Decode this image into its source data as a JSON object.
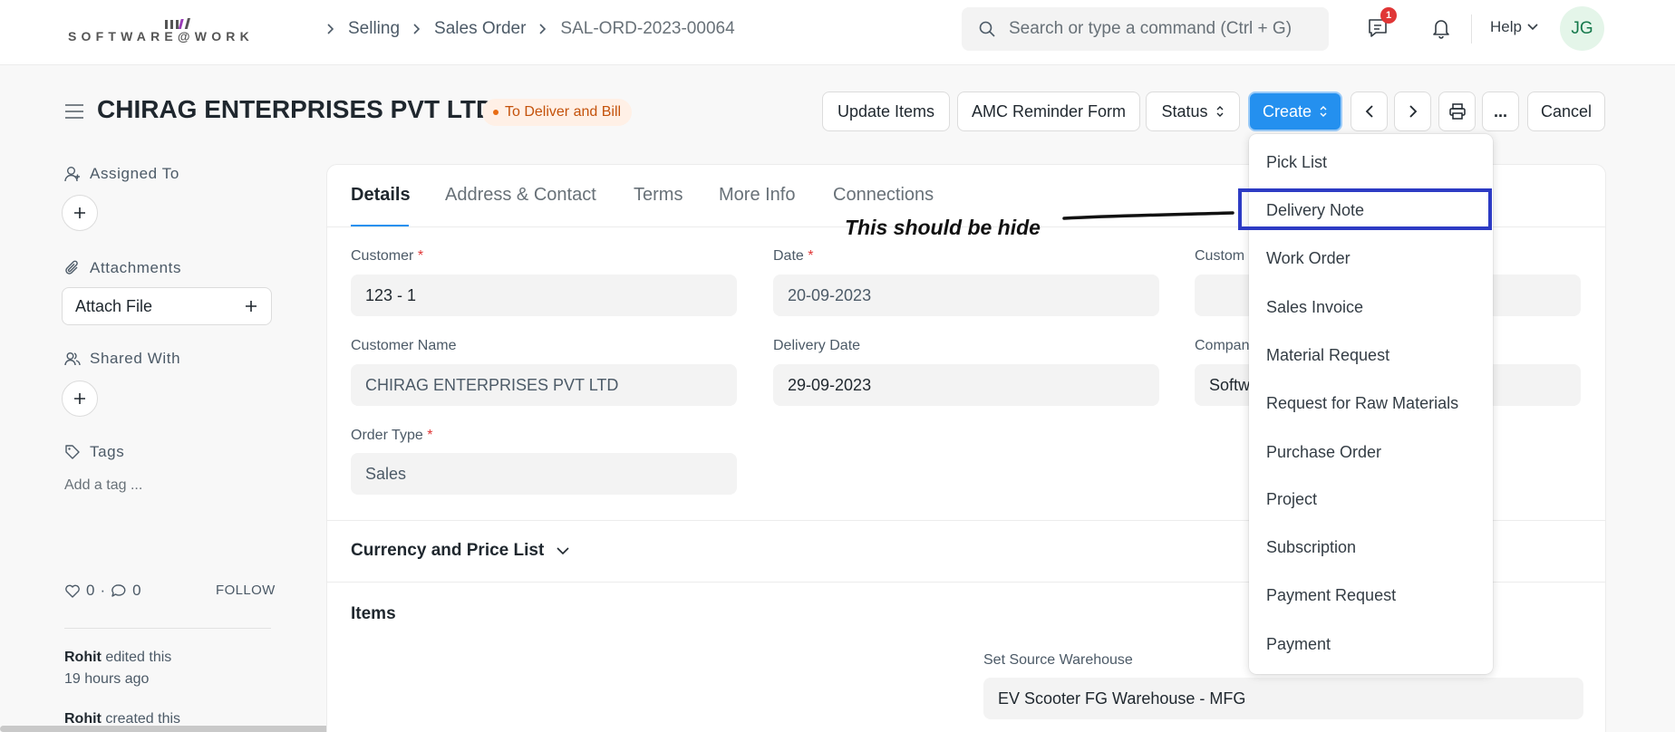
{
  "app": {
    "logo_text": "SOFTWARE@WORK"
  },
  "breadcrumbs": [
    "Selling",
    "Sales Order",
    "SAL-ORD-2023-00064"
  ],
  "search": {
    "placeholder": "Search or type a command (Ctrl + G)"
  },
  "navbar": {
    "notification_count": "1",
    "help_label": "Help",
    "avatar_initials": "JG"
  },
  "page": {
    "title": "CHIRAG ENTERPRISES PVT LTD",
    "status": "To Deliver and Bill"
  },
  "toolbar": {
    "update_items": "Update Items",
    "amc_reminder": "AMC Reminder Form",
    "status": "Status",
    "create": "Create",
    "more": "...",
    "cancel": "Cancel"
  },
  "sidebar": {
    "assigned_to": "Assigned To",
    "attachments": "Attachments",
    "attach_file": "Attach File",
    "shared_with": "Shared With",
    "tags": "Tags",
    "add_tag": "Add a tag ...",
    "likes": "0",
    "comments": "0",
    "follow": "FOLLOW",
    "activity": [
      {
        "user": "Rohit",
        "action": "edited this",
        "time": "19 hours ago"
      },
      {
        "user": "Rohit",
        "action": "created this"
      }
    ]
  },
  "tabs": [
    "Details",
    "Address & Contact",
    "Terms",
    "More Info",
    "Connections"
  ],
  "fields": {
    "customer_label": "Customer",
    "customer_value": "123 - 1",
    "date_label": "Date",
    "date_value": "20-09-2023",
    "customer_po_label": "Custom",
    "customer_name_label": "Customer Name",
    "customer_name_value": "CHIRAG ENTERPRISES PVT LTD",
    "delivery_date_label": "Delivery Date",
    "delivery_date_value": "29-09-2023",
    "company_label": "Compan",
    "company_value": "Softw",
    "order_type_label": "Order Type",
    "order_type_value": "Sales",
    "required_mark": "*"
  },
  "sections": {
    "currency": "Currency and Price List",
    "items": "Items",
    "source_warehouse_label": "Set Source Warehouse",
    "source_warehouse_value": "EV Scooter FG Warehouse - MFG"
  },
  "annotation": {
    "text": "This should be hide"
  },
  "create_menu": [
    "Pick List",
    "Delivery Note",
    "Work Order",
    "Sales Invoice",
    "Material Request",
    "Request for Raw Materials",
    "Purchase Order",
    "Project",
    "Subscription",
    "Payment Request",
    "Payment"
  ],
  "colors": {
    "primary": "#2490ef",
    "status_text": "#c4520b",
    "status_bg": "#fff0e6",
    "highlight_border": "#2d3bc4",
    "required": "#e03636"
  }
}
